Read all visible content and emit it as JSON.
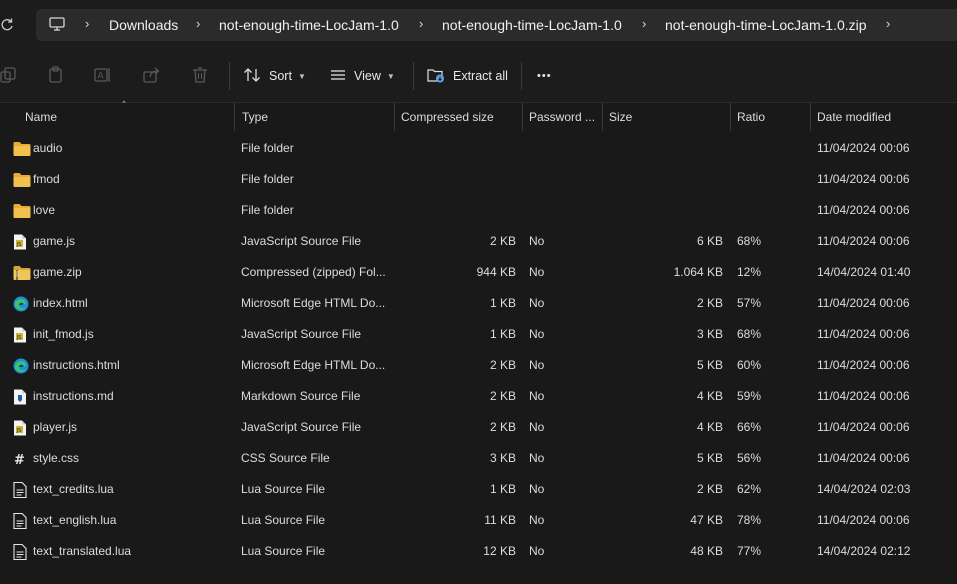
{
  "breadcrumbs": [
    "Downloads",
    "not-enough-time-LocJam-1.0",
    "not-enough-time-LocJam-1.0",
    "not-enough-time-LocJam-1.0.zip"
  ],
  "toolbar": {
    "sort_label": "Sort",
    "view_label": "View",
    "extract_label": "Extract all",
    "more_label": "•••"
  },
  "columns": {
    "name": "Name",
    "type": "Type",
    "compressed": "Compressed size",
    "password": "Password ...",
    "size": "Size",
    "ratio": "Ratio",
    "date": "Date modified"
  },
  "files": [
    {
      "name": "audio",
      "type": "File folder",
      "compressed": "",
      "password": "",
      "size": "",
      "ratio": "",
      "date": "11/04/2024 00:06",
      "icon": "folder-icon"
    },
    {
      "name": "fmod",
      "type": "File folder",
      "compressed": "",
      "password": "",
      "size": "",
      "ratio": "",
      "date": "11/04/2024 00:06",
      "icon": "folder-icon"
    },
    {
      "name": "love",
      "type": "File folder",
      "compressed": "",
      "password": "",
      "size": "",
      "ratio": "",
      "date": "11/04/2024 00:06",
      "icon": "folder-icon"
    },
    {
      "name": "game.js",
      "type": "JavaScript Source File",
      "compressed": "2 KB",
      "password": "No",
      "size": "6 KB",
      "ratio": "68%",
      "date": "11/04/2024 00:06",
      "icon": "js-file-icon"
    },
    {
      "name": "game.zip",
      "type": "Compressed (zipped) Fol...",
      "compressed": "944 KB",
      "password": "No",
      "size": "1.064 KB",
      "ratio": "12%",
      "date": "14/04/2024 01:40",
      "icon": "zip-folder-icon"
    },
    {
      "name": "index.html",
      "type": "Microsoft Edge HTML Do...",
      "compressed": "1 KB",
      "password": "No",
      "size": "2 KB",
      "ratio": "57%",
      "date": "11/04/2024 00:06",
      "icon": "edge-icon"
    },
    {
      "name": "init_fmod.js",
      "type": "JavaScript Source File",
      "compressed": "1 KB",
      "password": "No",
      "size": "3 KB",
      "ratio": "68%",
      "date": "11/04/2024 00:06",
      "icon": "js-file-icon"
    },
    {
      "name": "instructions.html",
      "type": "Microsoft Edge HTML Do...",
      "compressed": "2 KB",
      "password": "No",
      "size": "5 KB",
      "ratio": "60%",
      "date": "11/04/2024 00:06",
      "icon": "edge-icon"
    },
    {
      "name": "instructions.md",
      "type": "Markdown Source File",
      "compressed": "2 KB",
      "password": "No",
      "size": "4 KB",
      "ratio": "59%",
      "date": "11/04/2024 00:06",
      "icon": "markdown-file-icon"
    },
    {
      "name": "player.js",
      "type": "JavaScript Source File",
      "compressed": "2 KB",
      "password": "No",
      "size": "4 KB",
      "ratio": "66%",
      "date": "11/04/2024 00:06",
      "icon": "js-file-icon"
    },
    {
      "name": "style.css",
      "type": "CSS Source File",
      "compressed": "3 KB",
      "password": "No",
      "size": "5 KB",
      "ratio": "56%",
      "date": "11/04/2024 00:06",
      "icon": "css-file-icon"
    },
    {
      "name": "text_credits.lua",
      "type": "Lua Source File",
      "compressed": "1 KB",
      "password": "No",
      "size": "2 KB",
      "ratio": "62%",
      "date": "14/04/2024 02:03",
      "icon": "text-file-icon"
    },
    {
      "name": "text_english.lua",
      "type": "Lua Source File",
      "compressed": "11 KB",
      "password": "No",
      "size": "47 KB",
      "ratio": "78%",
      "date": "11/04/2024 00:06",
      "icon": "text-file-icon"
    },
    {
      "name": "text_translated.lua",
      "type": "Lua Source File",
      "compressed": "12 KB",
      "password": "No",
      "size": "48 KB",
      "ratio": "77%",
      "date": "14/04/2024 02:12",
      "icon": "text-file-icon"
    }
  ],
  "colors": {
    "background": "#191919",
    "folder": "#f2c04c",
    "js_badge": "#c9b43a",
    "edge_blue": "#1f8fd8",
    "extract_accent": "#5aa6e8"
  }
}
